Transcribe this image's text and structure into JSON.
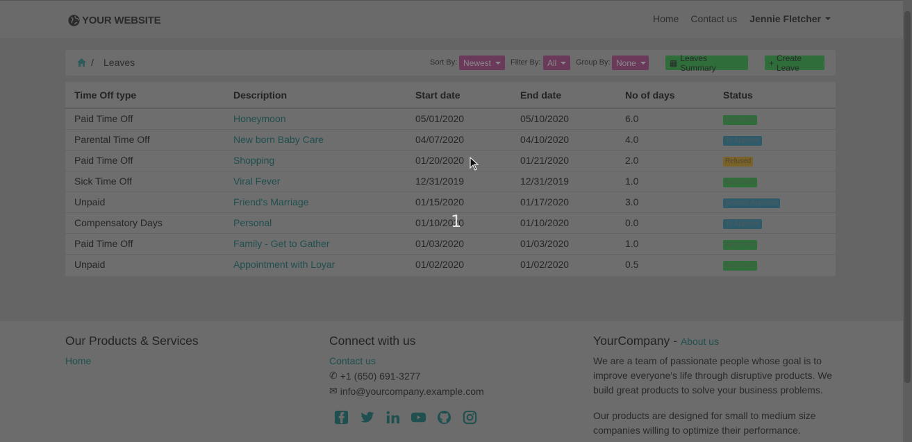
{
  "navbar": {
    "brand": "YOUR WEBSITE",
    "links": [
      "Home",
      "Contact us"
    ],
    "user": "Jennie Fletcher"
  },
  "breadcrumb": {
    "current": "Leaves",
    "separator": "/"
  },
  "controls": {
    "sort_label": "Sort By:",
    "sort_value": "Newest",
    "filter_label": "Filter By:",
    "filter_value": "All",
    "group_label": "Group By:",
    "group_value": "None",
    "summary_button": "Leaves Summary",
    "create_button": "Create Leave"
  },
  "table": {
    "headers": [
      "Time Off type",
      "Description",
      "Start date",
      "End date",
      "No of days",
      "Status"
    ],
    "rows": [
      {
        "type": "Paid Time Off",
        "desc": "Honeymoon",
        "start": "05/01/2020",
        "end": "05/10/2020",
        "days": "6.0",
        "status": "Approved",
        "status_kind": "approved"
      },
      {
        "type": "Parental Time Off",
        "desc": "New born Baby Care",
        "start": "04/07/2020",
        "end": "04/10/2020",
        "days": "4.0",
        "status": "To Approve",
        "status_kind": "toapprove"
      },
      {
        "type": "Paid Time Off",
        "desc": "Shopping",
        "start": "01/20/2020",
        "end": "01/21/2020",
        "days": "2.0",
        "status": "Refused",
        "status_kind": "refused"
      },
      {
        "type": "Sick Time Off",
        "desc": "Viral Fever",
        "start": "12/31/2019",
        "end": "12/31/2019",
        "days": "1.0",
        "status": "Approved",
        "status_kind": "approved"
      },
      {
        "type": "Unpaid",
        "desc": "Friend's Marriage",
        "start": "01/15/2020",
        "end": "01/17/2020",
        "days": "3.0",
        "status": "Second Approval",
        "status_kind": "second"
      },
      {
        "type": "Compensatory Days",
        "desc": "Personal",
        "start": "01/10/2020",
        "end": "01/10/2020",
        "days": "0.0",
        "status": "To Approve",
        "status_kind": "toapprove"
      },
      {
        "type": "Paid Time Off",
        "desc": "Family - Get to Gather",
        "start": "01/03/2020",
        "end": "01/03/2020",
        "days": "1.0",
        "status": "Approved",
        "status_kind": "approved"
      },
      {
        "type": "Unpaid",
        "desc": "Appointment with Loyar",
        "start": "01/02/2020",
        "end": "01/02/2020",
        "days": "0.5",
        "status": "Approved",
        "status_kind": "approved"
      }
    ]
  },
  "overlay_number": "1",
  "footer": {
    "col1_title": "Our Products & Services",
    "col1_link": "Home",
    "col2_title": "Connect with us",
    "col2_link": "Contact us",
    "phone": "+1 (650) 691-3277",
    "email": "info@yourcompany.example.com",
    "socials": [
      "facebook-icon",
      "twitter-icon",
      "linkedin-icon",
      "youtube-icon",
      "github-icon",
      "instagram-icon"
    ],
    "col3_title": "YourCompany",
    "col3_title_sep": " - ",
    "col3_link": "About us",
    "about_p1": "We are a team of passionate people whose goal is to improve everyone's life through disruptive products. We build great products to solve your business problems.",
    "about_p2": "Our products are designed for small to medium size companies willing to optimize their performance."
  }
}
